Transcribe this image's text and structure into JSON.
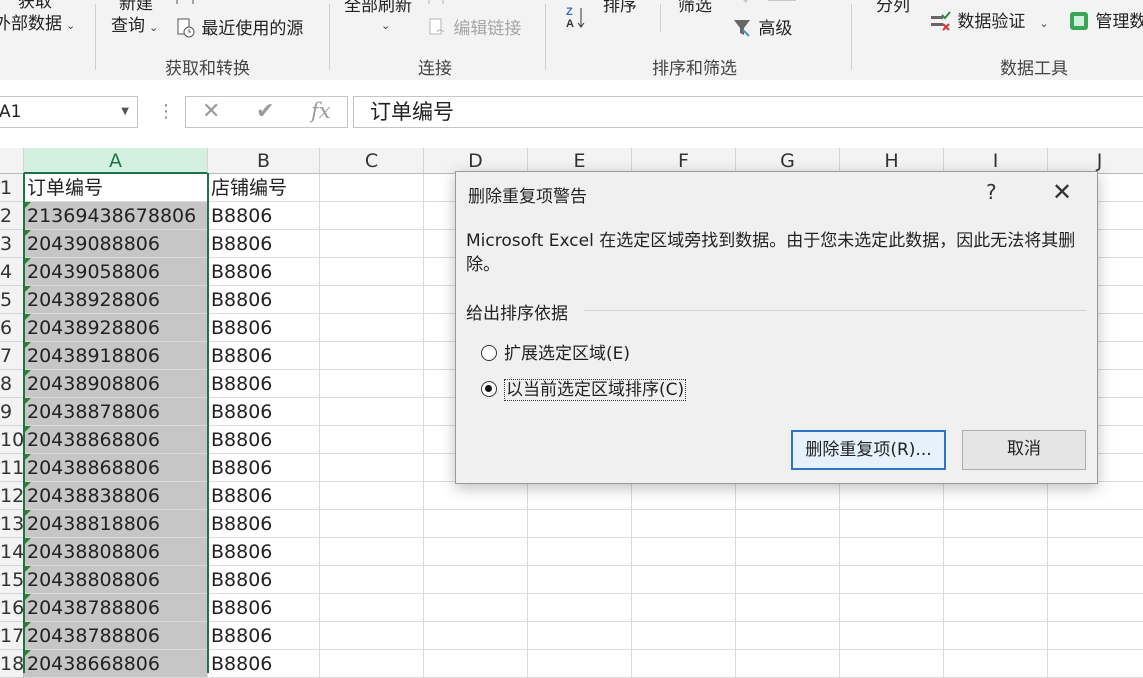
{
  "ribbon": {
    "get_data": {
      "line1": "获取",
      "line2": "外部数据"
    },
    "new_query": {
      "line1": "新建",
      "line2": "查询"
    },
    "recent_sources": "最近使用的源",
    "refresh_all": "全部刷新",
    "edit_links": "编辑链接",
    "sort": "排序",
    "filter": "筛选",
    "advanced": "高级",
    "text_to_columns": "分列",
    "data_validation": "数据验证",
    "manage_model": "管理数",
    "groups": {
      "get_transform": "获取和转换",
      "connections": "连接",
      "sort_filter": "排序和筛选",
      "data_tools": "数据工具"
    }
  },
  "formula_bar": {
    "name_box": "A1",
    "cancel": "✕",
    "enter": "✔",
    "fx": "fx",
    "content": "订单编号"
  },
  "grid": {
    "columns": [
      "A",
      "B",
      "C",
      "D",
      "E",
      "F",
      "G",
      "H",
      "I",
      "J"
    ],
    "rows": [
      {
        "num": "1",
        "a": "订单编号",
        "b": "店铺编号"
      },
      {
        "num": "2",
        "a": "21369438678806",
        "b": "B8806"
      },
      {
        "num": "3",
        "a": "20439088806",
        "b": "B8806"
      },
      {
        "num": "4",
        "a": "20439058806",
        "b": "B8806"
      },
      {
        "num": "5",
        "a": "20438928806",
        "b": "B8806"
      },
      {
        "num": "6",
        "a": "20438928806",
        "b": "B8806"
      },
      {
        "num": "7",
        "a": "20438918806",
        "b": "B8806"
      },
      {
        "num": "8",
        "a": "20438908806",
        "b": "B8806"
      },
      {
        "num": "9",
        "a": "20438878806",
        "b": "B8806"
      },
      {
        "num": "10",
        "a": "20438868806",
        "b": "B8806"
      },
      {
        "num": "11",
        "a": "20438868806",
        "b": "B8806"
      },
      {
        "num": "12",
        "a": "20438838806",
        "b": "B8806"
      },
      {
        "num": "13",
        "a": "20438818806",
        "b": "B8806"
      },
      {
        "num": "14",
        "a": "20438808806",
        "b": "B8806"
      },
      {
        "num": "15",
        "a": "20438808806",
        "b": "B8806"
      },
      {
        "num": "16",
        "a": "20438788806",
        "b": "B8806"
      },
      {
        "num": "17",
        "a": "20438788806",
        "b": "B8806"
      },
      {
        "num": "18",
        "a": "20438668806",
        "b": "B8806"
      }
    ]
  },
  "dialog": {
    "title": "删除重复项警告",
    "help": "?",
    "close": "✕",
    "message": "Microsoft Excel 在选定区域旁找到数据。由于您未选定此数据，因此无法将其删除。",
    "section_label": "给出排序依据",
    "option_expand": "扩展选定区域(E)",
    "option_current": "以当前选定区域排序(C)",
    "selected_option": "current",
    "btn_remove": "删除重复项(R)...",
    "btn_cancel": "取消"
  }
}
